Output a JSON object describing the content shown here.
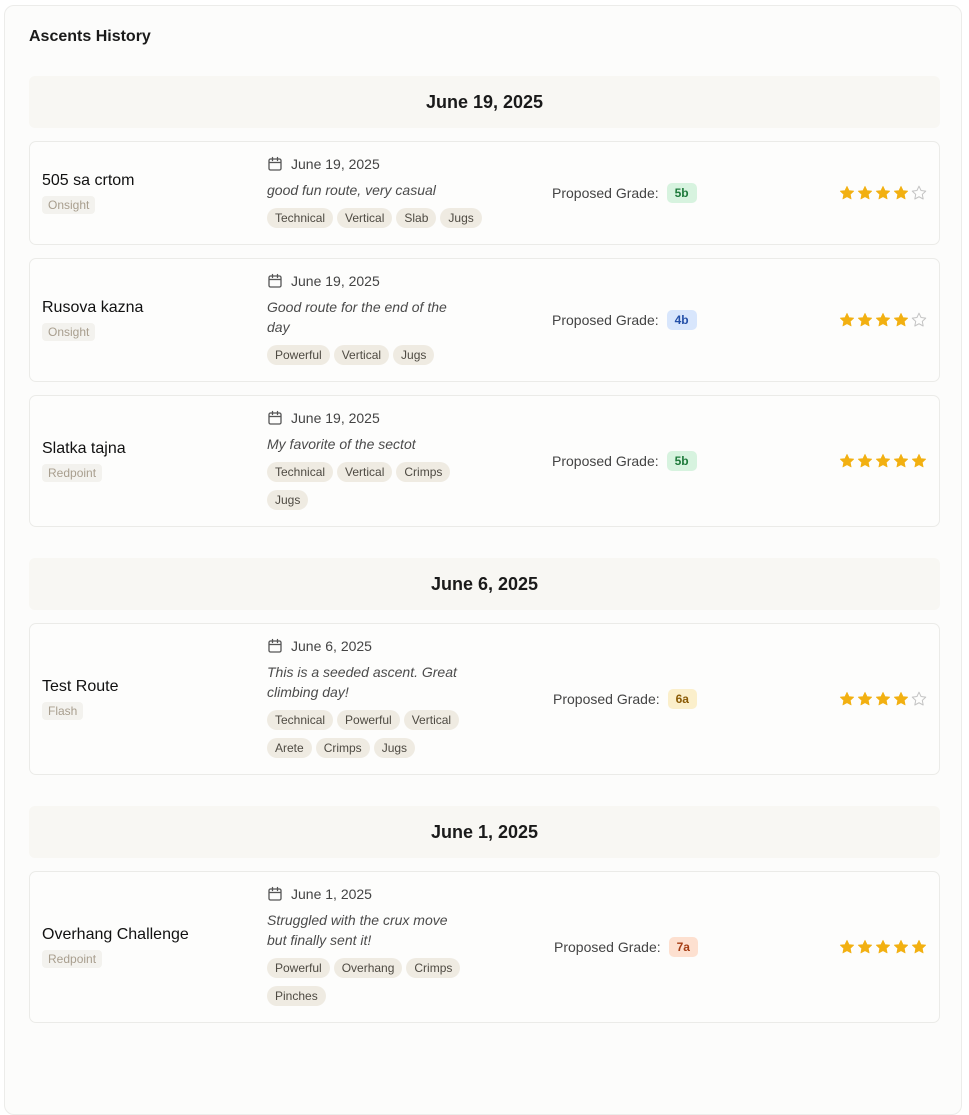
{
  "page": {
    "title": "Ascents History"
  },
  "grade_label": "Proposed Grade:",
  "colors": {
    "star_filled": "#f2b011",
    "star_empty": "#c4c4c4",
    "grade_5b": {
      "bg": "#d7f3df",
      "fg": "#1e7a3b"
    },
    "grade_4b": {
      "bg": "#d8e6fc",
      "fg": "#2450a8"
    },
    "grade_6a": {
      "bg": "#fbefcb",
      "fg": "#8a5a05"
    },
    "grade_7a": {
      "bg": "#fde0d0",
      "fg": "#a53d14"
    }
  },
  "groups": [
    {
      "date": "June 19, 2025",
      "ascents": [
        {
          "name": "505 sa crtom",
          "style": "Onsight",
          "date": "June 19, 2025",
          "comment_lines": [
            "good fun route, very casual"
          ],
          "tags": [
            "Technical",
            "Vertical",
            "Slab",
            "Jugs"
          ],
          "grade": "5b",
          "rating": 4
        },
        {
          "name": "Rusova kazna",
          "style": "Onsight",
          "date": "June 19, 2025",
          "comment_lines": [
            "Good route for the end of the",
            "day"
          ],
          "tags": [
            "Powerful",
            "Vertical",
            "Jugs"
          ],
          "grade": "4b",
          "rating": 4
        },
        {
          "name": "Slatka tajna",
          "style": "Redpoint",
          "date": "June 19, 2025",
          "comment_lines": [
            "My favorite of the sectot"
          ],
          "tags": [
            "Technical",
            "Vertical",
            "Crimps",
            "Jugs"
          ],
          "grade": "5b",
          "rating": 5
        }
      ]
    },
    {
      "date": "June 6, 2025",
      "ascents": [
        {
          "name": "Test Route",
          "style": "Flash",
          "date": "June 6, 2025",
          "comment_lines": [
            "This is a seeded ascent. Great",
            "climbing day!"
          ],
          "tags": [
            "Technical",
            "Powerful",
            "Vertical",
            "Arete",
            "Crimps",
            "Jugs"
          ],
          "grade": "6a",
          "rating": 4
        }
      ]
    },
    {
      "date": "June 1, 2025",
      "ascents": [
        {
          "name": "Overhang Challenge",
          "style": "Redpoint",
          "date": "June 1, 2025",
          "comment_lines": [
            "Struggled with the crux move",
            "but finally sent it!"
          ],
          "tags": [
            "Powerful",
            "Overhang",
            "Crimps",
            "Pinches"
          ],
          "grade": "7a",
          "rating": 5
        }
      ]
    }
  ]
}
